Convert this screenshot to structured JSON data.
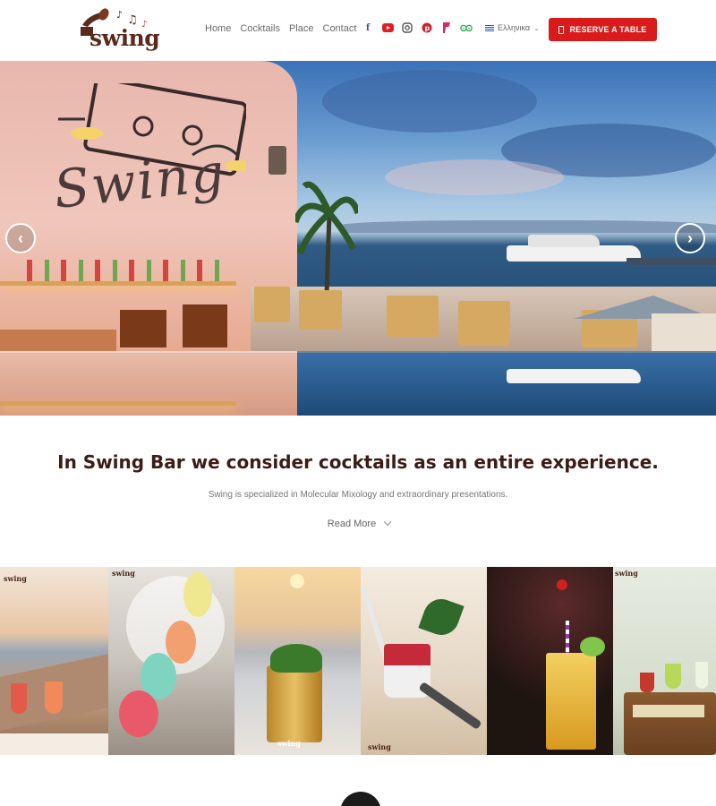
{
  "brand": {
    "name": "swing"
  },
  "nav": {
    "items": [
      {
        "label": "Home"
      },
      {
        "label": "Cocktails"
      },
      {
        "label": "Place"
      },
      {
        "label": "Contact"
      }
    ]
  },
  "socials": [
    {
      "icon": "facebook-icon",
      "glyph": "f",
      "color": "#3b5998"
    },
    {
      "icon": "youtube-icon",
      "glyph": "▶",
      "color": "#e02020"
    },
    {
      "icon": "instagram-icon",
      "glyph": "◎",
      "color": "#555555"
    },
    {
      "icon": "pinterest-icon",
      "glyph": "P",
      "color": "#d0202a"
    },
    {
      "icon": "foursquare-icon",
      "glyph": "F",
      "color": "#e0245e"
    },
    {
      "icon": "tripadvisor-icon",
      "glyph": "oo",
      "color": "#34a853"
    }
  ],
  "language": {
    "selected": "Ελληνικα"
  },
  "reserve": {
    "label": "RESERVE A TABLE"
  },
  "hero": {
    "wall_sign": "Swing"
  },
  "intro": {
    "headline": "In Swing Bar we consider cocktails as an entire experience.",
    "subline": "Swing is specialized in Molecular Mixology and extraordinary presentations.",
    "read_more": "Read More"
  },
  "gallery": {
    "watermark": "swing"
  },
  "colors": {
    "accent": "#d91b1b",
    "brand": "#5a2a1c"
  }
}
